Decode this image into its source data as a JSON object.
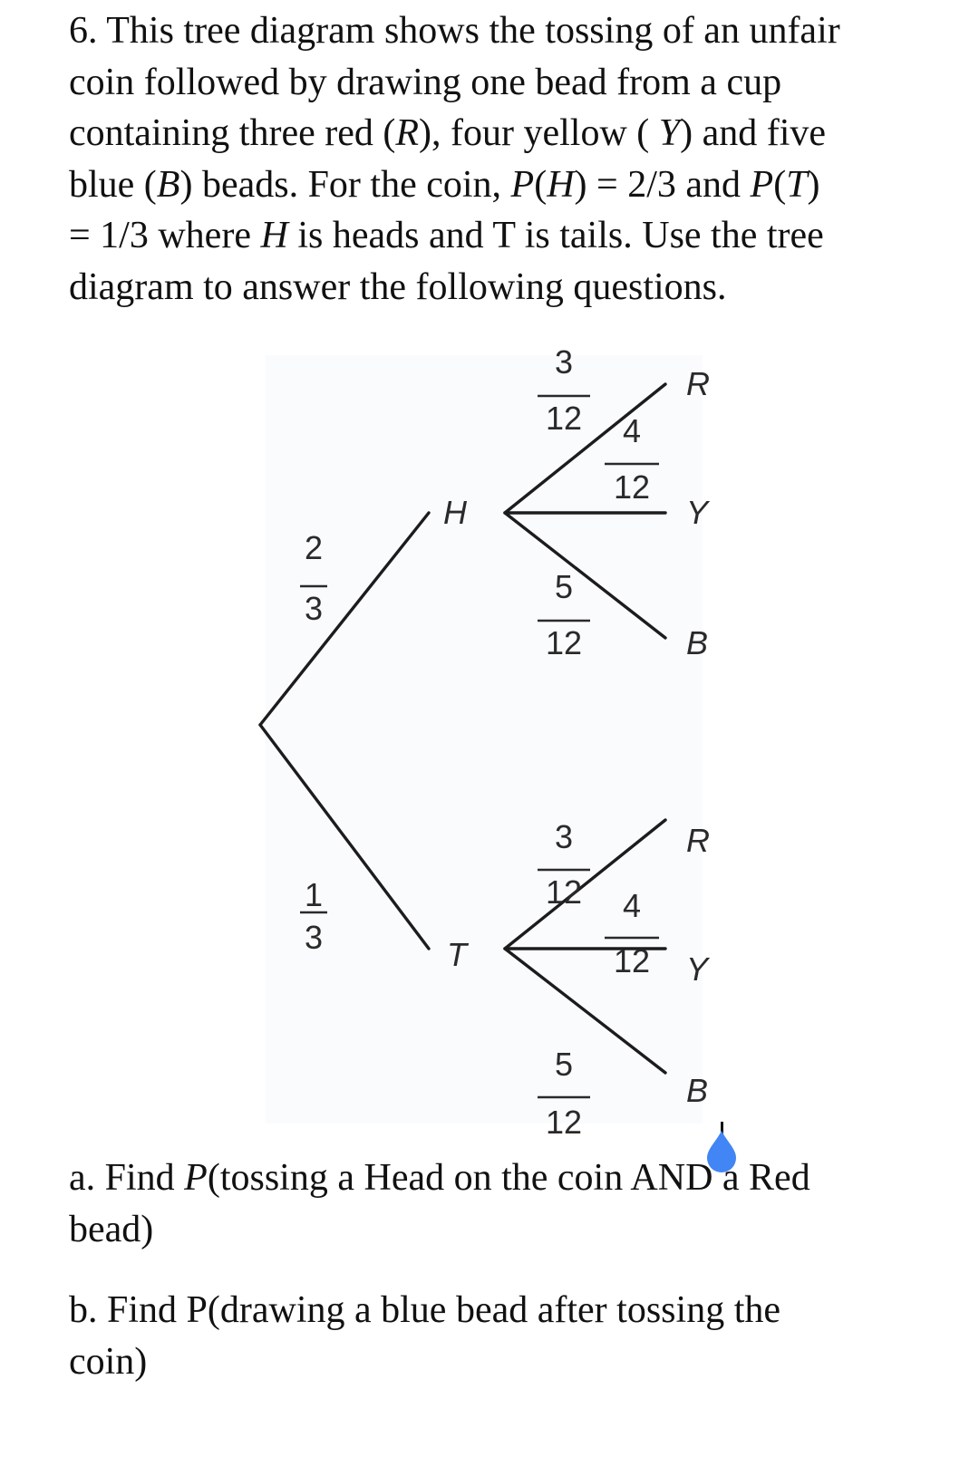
{
  "question": {
    "intro_lines": [
      "6. This tree diagram shows the tossing of an unfair",
      "coin followed by drawing one bead from a cup",
      "containing three red (R), four yellow (Y) and five",
      "blue (B) beads. For the coin, P(H) = 2/3  and P(T)",
      "= 1/3  where H is heads and T is tails. Use the tree",
      "diagram to answer the following questions."
    ],
    "part_a_lines": [
      "a. Find P(tossing a Head on the coin AND a Red",
      "bead)"
    ],
    "part_b_lines": [
      "b. Find P(drawing a blue bead after tossing the",
      "coin)"
    ]
  },
  "tree": {
    "first_stage": [
      {
        "node": "H",
        "prob_num": "2",
        "prob_den": "3"
      },
      {
        "node": "T",
        "prob_num": "1",
        "prob_den": "3"
      }
    ],
    "second_stage": {
      "H": [
        {
          "node": "R",
          "prob_num": "3",
          "prob_den": "12"
        },
        {
          "node": "Y",
          "prob_num": "4",
          "prob_den": "12"
        },
        {
          "node": "B",
          "prob_num": "5",
          "prob_den": "12"
        }
      ],
      "T": [
        {
          "node": "R",
          "prob_num": "3",
          "prob_den": "12"
        },
        {
          "node": "Y",
          "prob_num": "4",
          "prob_den": "12"
        },
        {
          "node": "B",
          "prob_num": "5",
          "prob_den": "12"
        }
      ]
    }
  },
  "selection_handle": {
    "color": "#4285f4",
    "icon": "text-selection-handle-icon"
  }
}
